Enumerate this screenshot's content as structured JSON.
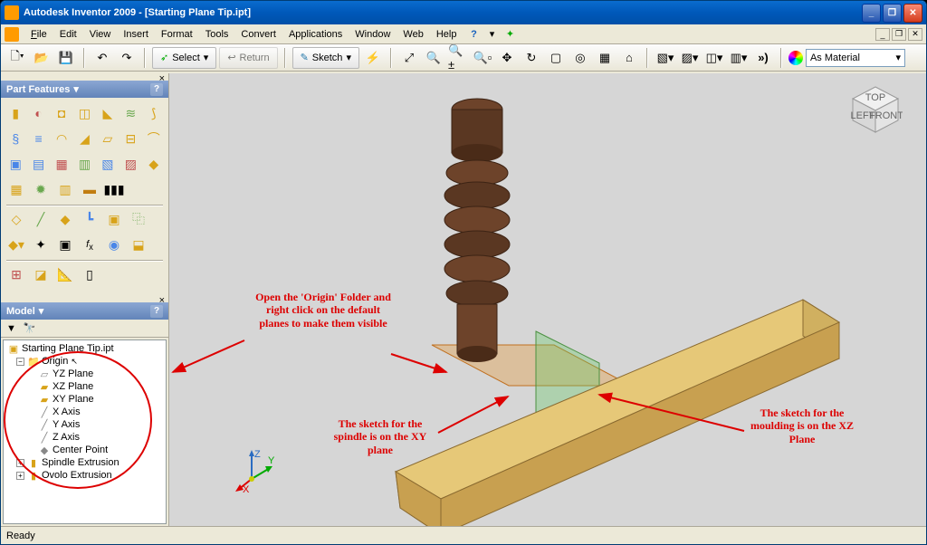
{
  "title": "Autodesk Inventor 2009 - [Starting Plane Tip.ipt]",
  "menu": {
    "file": "File",
    "edit": "Edit",
    "view": "View",
    "insert": "Insert",
    "format": "Format",
    "tools": "Tools",
    "convert": "Convert",
    "applications": "Applications",
    "window": "Window",
    "web": "Web",
    "help": "Help"
  },
  "toolbar": {
    "select": "Select",
    "return": "Return",
    "sketch": "Sketch",
    "material": "As Material"
  },
  "panels": {
    "features_title": "Part Features",
    "model_title": "Model"
  },
  "tree": {
    "root": "Starting Plane Tip.ipt",
    "origin": "Origin",
    "yz": "YZ Plane",
    "xz": "XZ Plane",
    "xy": "XY Plane",
    "xaxis": "X Axis",
    "yaxis": "Y Axis",
    "zaxis": "Z Axis",
    "center": "Center Point",
    "spindle": "Spindle Extrusion",
    "ovolo": "Ovolo Extrusion"
  },
  "annotations": {
    "origin": "Open the 'Origin' Folder and right click on the default planes to make them visible",
    "spindle": "The sketch for the spindle is on the XY plane",
    "moulding": "The sketch for the moulding is on the XZ Plane"
  },
  "triad": {
    "x": "X",
    "y": "Y",
    "z": "Z"
  },
  "status": "Ready",
  "cube": {
    "top": "TOP",
    "left": "LEFT",
    "front": "FRONT"
  }
}
